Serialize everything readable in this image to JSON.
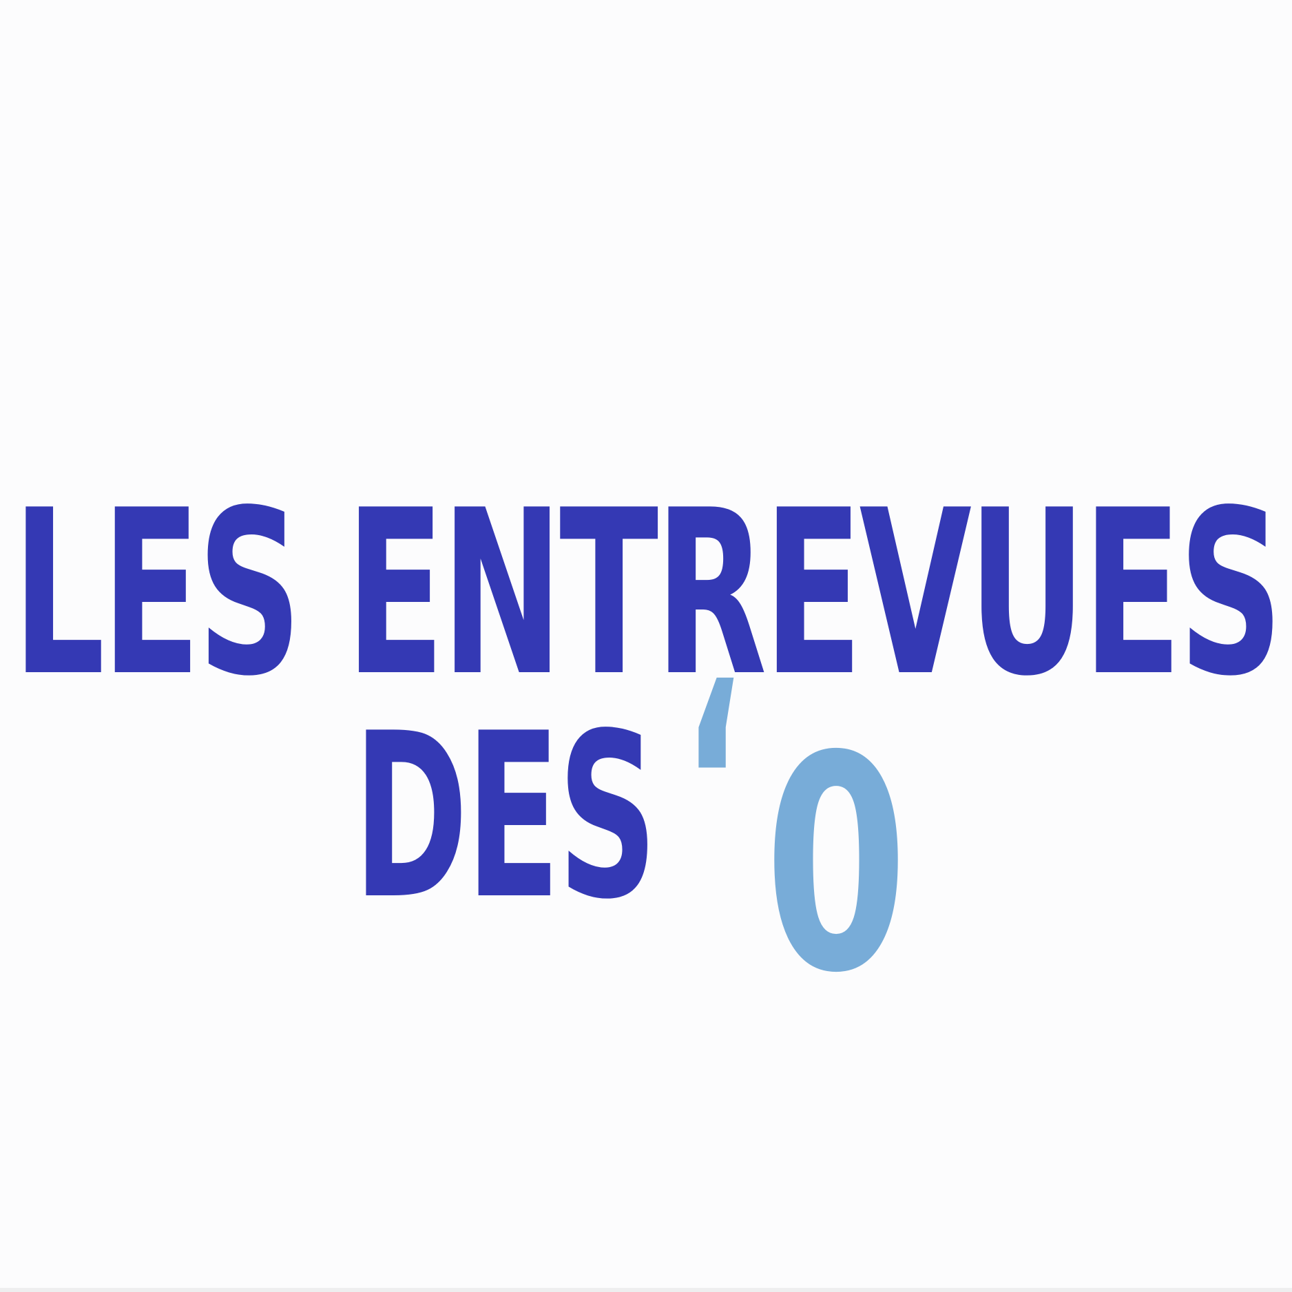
{
  "logo": {
    "line_1": "LES ENTREVUES",
    "line_2": "DES",
    "quote": "‘",
    "zero": "0"
  },
  "colors": {
    "primary_blue": "#3439b4",
    "light_blue": "#78acd8",
    "background": "#fcfcfd"
  }
}
